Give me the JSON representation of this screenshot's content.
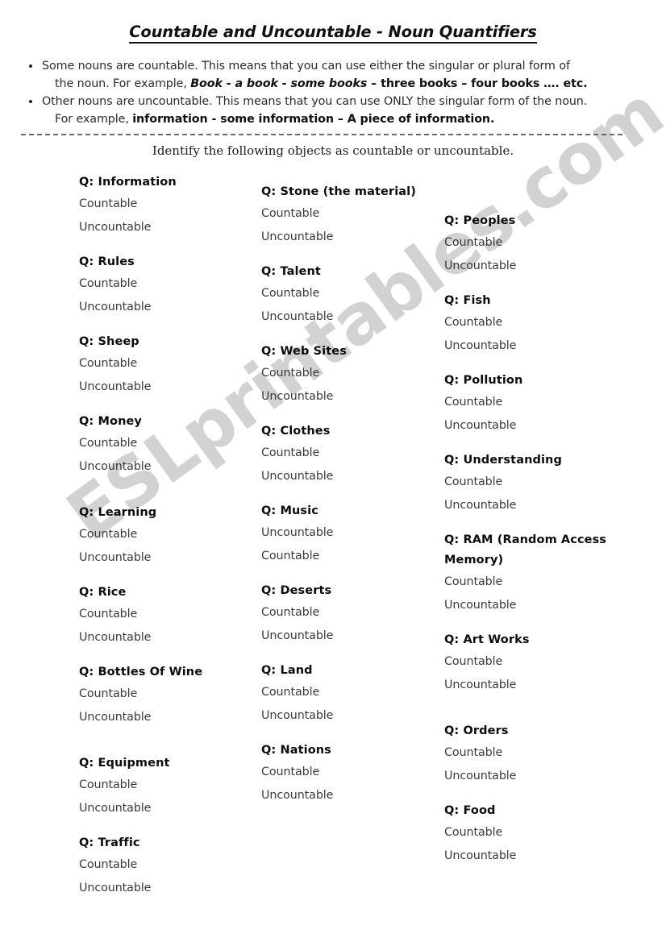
{
  "document": {
    "title": "Countable and Uncountable - Noun Quantifiers",
    "watermark": "ESLprintables.com",
    "watermark_color": "#d2d2d2",
    "background_color": "#ffffff",
    "text_color": "#1a1a1a"
  },
  "intro": {
    "bullets": [
      {
        "line1": "Some nouns are countable.  This means that  you can use either the singular or plural form of",
        "line2_prefix": "the noun. For example, ",
        "line2_italic_bold": "Book - a book - some books",
        "line2_bold": " – three books – four  books …. etc."
      },
      {
        "line1": "Other nouns are uncountable.  This means that you can use ONLY the singular form of the noun.",
        "line2_prefix": "For example,  ",
        "line2_bold": "information - some information – A piece of information."
      }
    ],
    "instruction": "Identify the following objects as countable or uncountable."
  },
  "columns": [
    {
      "name": "column-1",
      "questions": [
        {
          "prompt": "Q: Information",
          "options": [
            "Countable",
            "Uncountable"
          ],
          "extra_gap": false
        },
        {
          "prompt": "Q: Rules",
          "options": [
            "Countable",
            "Uncountable"
          ],
          "extra_gap": false
        },
        {
          "prompt": "Q: Sheep",
          "options": [
            "Countable",
            "Uncountable"
          ],
          "extra_gap": false
        },
        {
          "prompt": "Q: Money",
          "options": [
            "Countable",
            "Uncountable"
          ],
          "extra_gap": true
        },
        {
          "prompt": "Q: Learning",
          "options": [
            "Countable",
            "Uncountable"
          ],
          "extra_gap": false
        },
        {
          "prompt": "Q: Rice",
          "options": [
            "Countable",
            "Uncountable"
          ],
          "extra_gap": false
        },
        {
          "prompt": "Q: Bottles Of Wine",
          "options": [
            "Countable",
            "Uncountable"
          ],
          "extra_gap": true
        },
        {
          "prompt": "Q: Equipment",
          "options": [
            "Countable",
            "Uncountable"
          ],
          "extra_gap": false
        },
        {
          "prompt": "Q: Traffic",
          "options": [
            "Countable",
            "Uncountable"
          ],
          "extra_gap": false
        }
      ]
    },
    {
      "name": "column-2",
      "questions": [
        {
          "prompt": "Q: Stone (the material)",
          "options": [
            "Countable",
            "Uncountable"
          ],
          "extra_gap": false
        },
        {
          "prompt": "Q: Talent",
          "options": [
            "Countable",
            "Uncountable"
          ],
          "extra_gap": false
        },
        {
          "prompt": "Q: Web Sites",
          "options": [
            "Countable",
            "Uncountable"
          ],
          "extra_gap": false
        },
        {
          "prompt": "Q: Clothes",
          "options": [
            "Countable",
            "Uncountable"
          ],
          "extra_gap": false
        },
        {
          "prompt": "Q: Music",
          "options": [
            "Uncountable",
            "Countable"
          ],
          "extra_gap": false
        },
        {
          "prompt": "Q: Deserts",
          "options": [
            "Countable",
            "Uncountable"
          ],
          "extra_gap": false
        },
        {
          "prompt": "Q: Land",
          "options": [
            "Countable",
            "Uncountable"
          ],
          "extra_gap": false
        },
        {
          "prompt": "Q: Nations",
          "options": [
            "Countable",
            "Uncountable"
          ],
          "extra_gap": false
        }
      ]
    },
    {
      "name": "column-3",
      "questions": [
        {
          "prompt": "Q: Peoples",
          "options": [
            "Countable",
            "Uncountable"
          ],
          "extra_gap": false
        },
        {
          "prompt": "Q: Fish",
          "options": [
            "Countable",
            "Uncountable"
          ],
          "extra_gap": false
        },
        {
          "prompt": "Q: Pollution",
          "options": [
            "Countable",
            "Uncountable"
          ],
          "extra_gap": false
        },
        {
          "prompt": "Q: Understanding",
          "options": [
            "Countable",
            "Uncountable"
          ],
          "extra_gap": false
        },
        {
          "prompt": "Q: RAM (Random Access Memory)",
          "options": [
            "Countable",
            "Uncountable"
          ],
          "extra_gap": false
        },
        {
          "prompt": "Q: Art Works",
          "options": [
            "Countable",
            "Uncountable"
          ],
          "extra_gap": true
        },
        {
          "prompt": "Q: Orders",
          "options": [
            "Countable",
            "Uncountable"
          ],
          "extra_gap": false
        },
        {
          "prompt": "Q: Food",
          "options": [
            "Countable",
            "Uncountable"
          ],
          "extra_gap": false
        }
      ]
    }
  ]
}
